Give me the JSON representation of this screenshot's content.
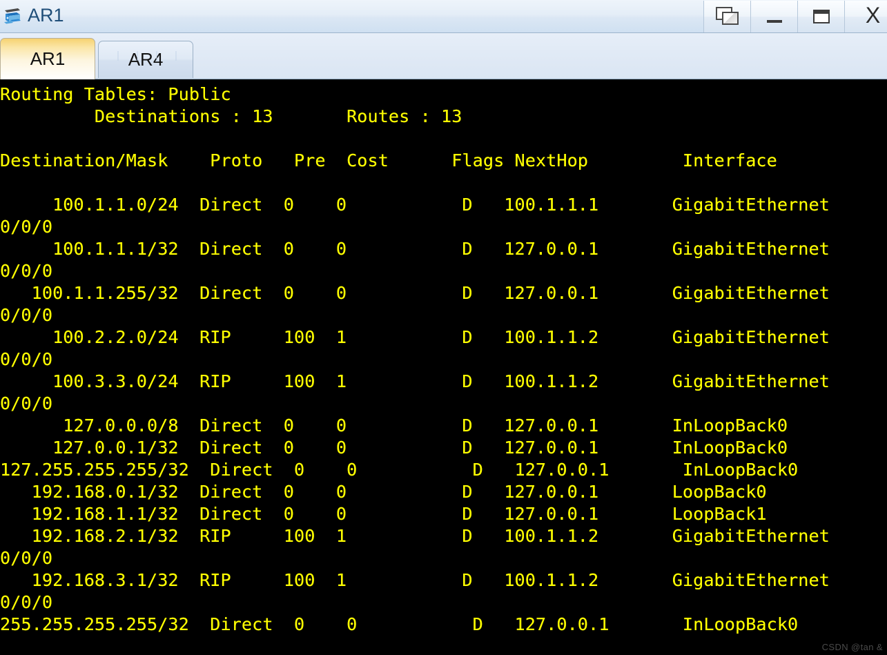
{
  "window": {
    "title": "AR1",
    "icon": "router-icon",
    "controls": [
      {
        "name": "cascade-windows-button",
        "icon": "cascade-icon",
        "label": ""
      },
      {
        "name": "minimize-button",
        "icon": "minimize-icon",
        "label": ""
      },
      {
        "name": "maximize-button",
        "icon": "maximize-icon",
        "label": ""
      },
      {
        "name": "close-button",
        "icon": "close-icon",
        "label": "X"
      }
    ]
  },
  "tabs": [
    {
      "label": "AR1",
      "active": true
    },
    {
      "label": "AR4",
      "active": false
    }
  ],
  "terminal": {
    "colors": {
      "background": "#000000",
      "text": "#ffff00"
    },
    "header": {
      "routing_tables_label": "Routing Tables:",
      "routing_tables_value": "Public",
      "destinations_label": "Destinations :",
      "destinations_value": "13",
      "routes_label": "Routes :",
      "routes_value": "13"
    },
    "columns": [
      "Destination/Mask",
      "Proto",
      "Pre",
      "Cost",
      "Flags",
      "NextHop",
      "Interface"
    ],
    "rows": [
      {
        "destination": "100.1.1.0/24",
        "proto": "Direct",
        "pre": "0",
        "cost": "0",
        "flags": "D",
        "nexthop": "100.1.1.1",
        "interface": "GigabitEthernet0/0/0"
      },
      {
        "destination": "100.1.1.1/32",
        "proto": "Direct",
        "pre": "0",
        "cost": "0",
        "flags": "D",
        "nexthop": "127.0.0.1",
        "interface": "GigabitEthernet0/0/0"
      },
      {
        "destination": "100.1.1.255/32",
        "proto": "Direct",
        "pre": "0",
        "cost": "0",
        "flags": "D",
        "nexthop": "127.0.0.1",
        "interface": "GigabitEthernet0/0/0"
      },
      {
        "destination": "100.2.2.0/24",
        "proto": "RIP",
        "pre": "100",
        "cost": "1",
        "flags": "D",
        "nexthop": "100.1.1.2",
        "interface": "GigabitEthernet0/0/0"
      },
      {
        "destination": "100.3.3.0/24",
        "proto": "RIP",
        "pre": "100",
        "cost": "1",
        "flags": "D",
        "nexthop": "100.1.1.2",
        "interface": "GigabitEthernet0/0/0"
      },
      {
        "destination": "127.0.0.0/8",
        "proto": "Direct",
        "pre": "0",
        "cost": "0",
        "flags": "D",
        "nexthop": "127.0.0.1",
        "interface": "InLoopBack0"
      },
      {
        "destination": "127.0.0.1/32",
        "proto": "Direct",
        "pre": "0",
        "cost": "0",
        "flags": "D",
        "nexthop": "127.0.0.1",
        "interface": "InLoopBack0"
      },
      {
        "destination": "127.255.255.255/32",
        "proto": "Direct",
        "pre": "0",
        "cost": "0",
        "flags": "D",
        "nexthop": "127.0.0.1",
        "interface": "InLoopBack0"
      },
      {
        "destination": "192.168.0.1/32",
        "proto": "Direct",
        "pre": "0",
        "cost": "0",
        "flags": "D",
        "nexthop": "127.0.0.1",
        "interface": "LoopBack0"
      },
      {
        "destination": "192.168.1.1/32",
        "proto": "Direct",
        "pre": "0",
        "cost": "0",
        "flags": "D",
        "nexthop": "127.0.0.1",
        "interface": "LoopBack1"
      },
      {
        "destination": "192.168.2.1/32",
        "proto": "RIP",
        "pre": "100",
        "cost": "1",
        "flags": "D",
        "nexthop": "100.1.1.2",
        "interface": "GigabitEthernet0/0/0"
      },
      {
        "destination": "192.168.3.1/32",
        "proto": "RIP",
        "pre": "100",
        "cost": "1",
        "flags": "D",
        "nexthop": "100.1.1.2",
        "interface": "GigabitEthernet0/0/0"
      },
      {
        "destination": "255.255.255.255/32",
        "proto": "Direct",
        "pre": "0",
        "cost": "0",
        "flags": "D",
        "nexthop": "127.0.0.1",
        "interface": "InLoopBack0"
      }
    ],
    "raw_text": "Routing Tables: Public\n         Destinations : 13       Routes : 13\n\nDestination/Mask    Proto   Pre  Cost      Flags NextHop         Interface\n\n     100.1.1.0/24  Direct  0    0           D   100.1.1.1       GigabitEthernet\n0/0/0\n     100.1.1.1/32  Direct  0    0           D   127.0.0.1       GigabitEthernet\n0/0/0\n   100.1.1.255/32  Direct  0    0           D   127.0.0.1       GigabitEthernet\n0/0/0\n     100.2.2.0/24  RIP     100  1           D   100.1.1.2       GigabitEthernet\n0/0/0\n     100.3.3.0/24  RIP     100  1           D   100.1.1.2       GigabitEthernet\n0/0/0\n      127.0.0.0/8  Direct  0    0           D   127.0.0.1       InLoopBack0\n     127.0.0.1/32  Direct  0    0           D   127.0.0.1       InLoopBack0\n127.255.255.255/32  Direct  0    0           D   127.0.0.1       InLoopBack0\n   192.168.0.1/32  Direct  0    0           D   127.0.0.1       LoopBack0\n   192.168.1.1/32  Direct  0    0           D   127.0.0.1       LoopBack1\n   192.168.2.1/32  RIP     100  1           D   100.1.1.2       GigabitEthernet\n0/0/0\n   192.168.3.1/32  RIP     100  1           D   100.1.1.2       GigabitEthernet\n0/0/0\n255.255.255.255/32  Direct  0    0           D   127.0.0.1       InLoopBack0"
  },
  "watermark": "CSDN @tan &"
}
